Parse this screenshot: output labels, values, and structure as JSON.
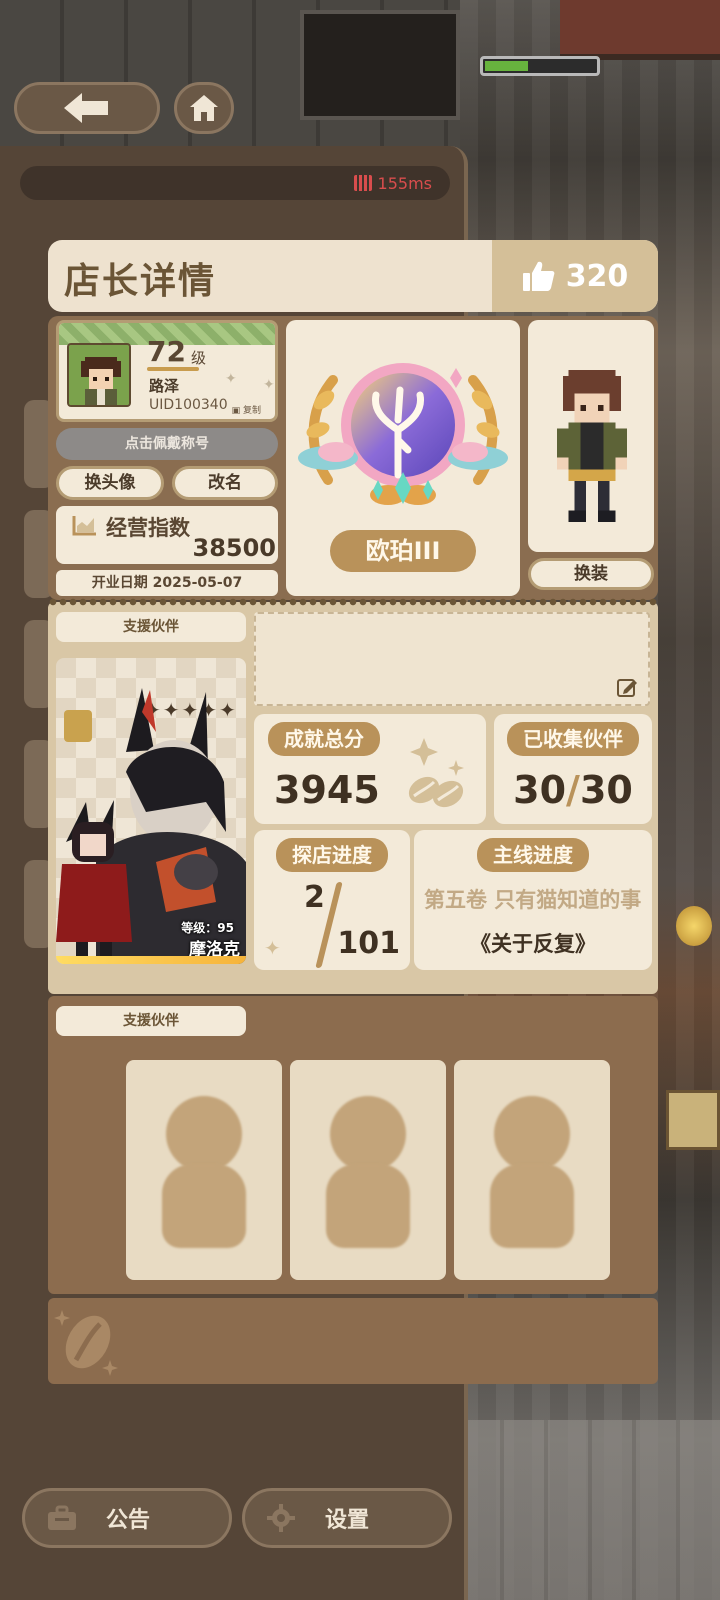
{
  "network": {
    "ping": "155ms"
  },
  "header": {
    "title": "店长详情",
    "likes": "320"
  },
  "profile": {
    "level": "72",
    "level_unit": "级",
    "name": "路泽",
    "uid": "UID100340",
    "copy_label": "复制",
    "title_placeholder": "点击佩戴称号",
    "change_avatar": "换头像",
    "rename": "改名",
    "business_index_label": "经营指数",
    "business_index_value": "38500",
    "open_date": "开业日期 2025-05-07",
    "badge_name": "欧珀III",
    "change_outfit": "换装"
  },
  "partner": {
    "label": "支援伙伴",
    "stars": "✦✦✦✦✦",
    "level_text": "等级：95",
    "name": "摩洛克"
  },
  "stats": {
    "achievement_label": "成就总分",
    "achievement_value": "3945",
    "collected_label": "已收集伙伴",
    "collected_have": "30",
    "collected_total": "30",
    "explore_label": "探店进度",
    "explore_current": "2",
    "explore_total": "101",
    "main_label": "主线进度",
    "main_chapter": "第五卷 只有猫知道的事",
    "main_title": "《关于反复》"
  },
  "support": {
    "label": "支援伙伴",
    "slots": [
      "",
      "",
      ""
    ]
  },
  "footer": {
    "notice": "公告",
    "settings": "设置"
  },
  "colors": {
    "accent": "#b9925a",
    "panel": "#f3ead9",
    "frame": "#8c6c4e"
  }
}
